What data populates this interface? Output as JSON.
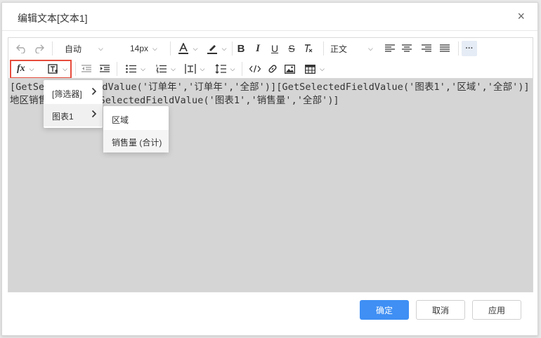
{
  "dialog": {
    "title": "编辑文本[文本1]",
    "close_glyph": "×"
  },
  "toolbar": {
    "auto_select": "自动",
    "font_size_select": "14px",
    "paragraph_select": "正文",
    "fx_label": "fx",
    "more_glyph": "···"
  },
  "editor": {
    "content": "[GetSelectedFieldValue('订单年','订单年','全部')][GetSelectedFieldValue('图表1','区域','全部')]地区销售情况：[GetSelectedFieldValue('图表1','销售量','全部')]"
  },
  "menu_level1": [
    {
      "label": "[筛选器]"
    },
    {
      "label": "图表1"
    }
  ],
  "menu_level2": [
    {
      "label": "区域"
    },
    {
      "label": "销售量 (合计)"
    }
  ],
  "footer": {
    "ok_label": "确定",
    "cancel_label": "取消",
    "apply_label": "应用"
  },
  "colors": {
    "primary": "#3f8ff4",
    "highlight_border": "#e74c3c",
    "editor_bg": "#d5d5d5"
  }
}
